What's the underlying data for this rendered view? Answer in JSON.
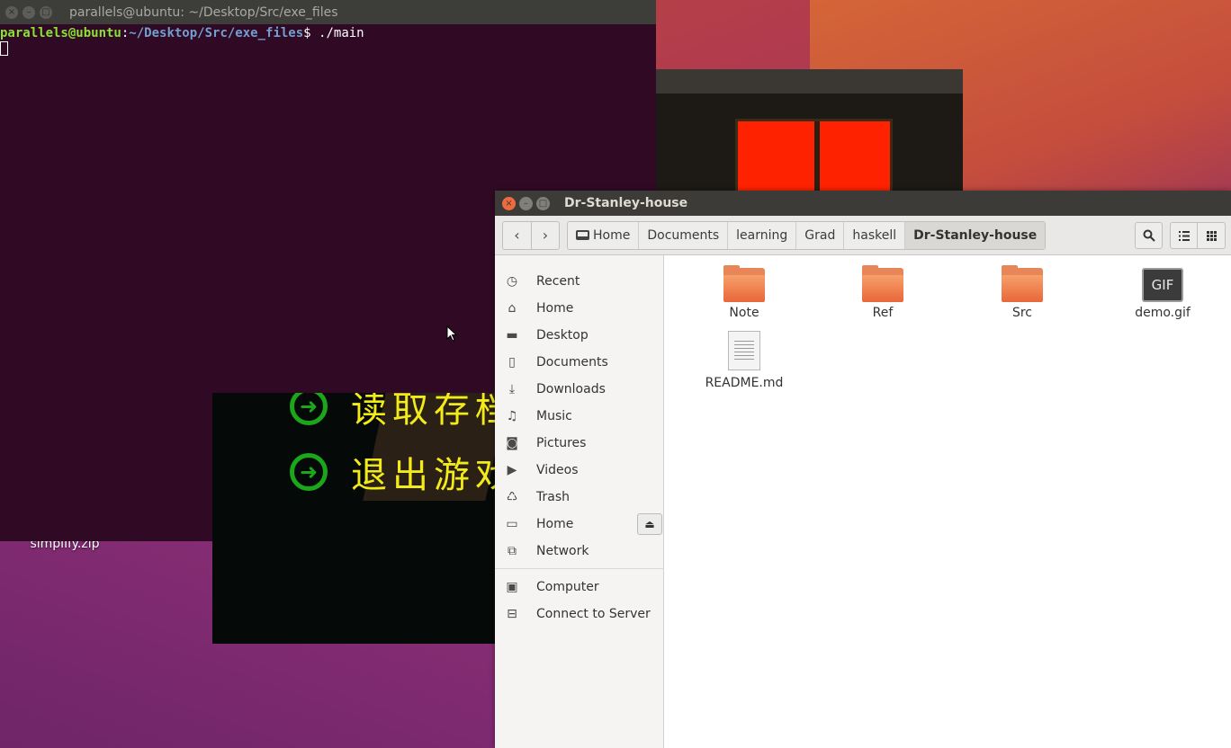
{
  "desktop": {
    "icon_label": "simplify.zip"
  },
  "game": {
    "menu": [
      {
        "arrow": "➜",
        "text": "读取存档"
      },
      {
        "arrow": "➜",
        "text": "退出游戏"
      }
    ],
    "colors": {
      "menu_text": "#f2ea1a",
      "arrow": "#1aa81a",
      "window": "#ff2200"
    }
  },
  "terminal": {
    "title": "parallels@ubuntu: ~/Desktop/Src/exe_files",
    "prompt_user": "parallels@ubuntu",
    "prompt_sep": ":",
    "prompt_path": "~/Desktop/Src/exe_files",
    "prompt_end": "$ ",
    "command": "./main",
    "colors": {
      "background": "#300a24",
      "user": "#8ae234",
      "path": "#729fcf"
    }
  },
  "file_manager": {
    "title": "Dr-Stanley-house",
    "nav": {
      "back_icon": "‹",
      "forward_icon": "›"
    },
    "breadcrumbs": [
      "Home",
      "Documents",
      "learning",
      "Grad",
      "haskell",
      "Dr-Stanley-house"
    ],
    "toolbar": {
      "search_icon": "search-icon",
      "list_icon": "list-view-icon",
      "grid_icon": "grid-view-icon"
    },
    "sidebar": [
      {
        "label": "Recent",
        "icon": "clock-icon"
      },
      {
        "label": "Home",
        "icon": "home-icon"
      },
      {
        "label": "Desktop",
        "icon": "folder-icon"
      },
      {
        "label": "Documents",
        "icon": "document-icon"
      },
      {
        "label": "Downloads",
        "icon": "download-icon"
      },
      {
        "label": "Music",
        "icon": "music-icon"
      },
      {
        "label": "Pictures",
        "icon": "camera-icon"
      },
      {
        "label": "Videos",
        "icon": "video-icon"
      },
      {
        "label": "Trash",
        "icon": "trash-icon"
      },
      {
        "label": "Home",
        "icon": "drive-icon"
      },
      {
        "label": "Network",
        "icon": "network-icon"
      },
      {
        "label": "Computer",
        "icon": "computer-icon"
      },
      {
        "label": "Connect to Server",
        "icon": "server-icon"
      }
    ],
    "files": [
      {
        "name": "Note",
        "type": "folder"
      },
      {
        "name": "Ref",
        "type": "folder"
      },
      {
        "name": "Src",
        "type": "folder"
      },
      {
        "name": "demo.gif",
        "type": "gif",
        "badge": "GIF"
      },
      {
        "name": "README.md",
        "type": "text"
      }
    ],
    "colors": {
      "folder": "#e8663a",
      "close_button": "#ef6b3f"
    }
  }
}
